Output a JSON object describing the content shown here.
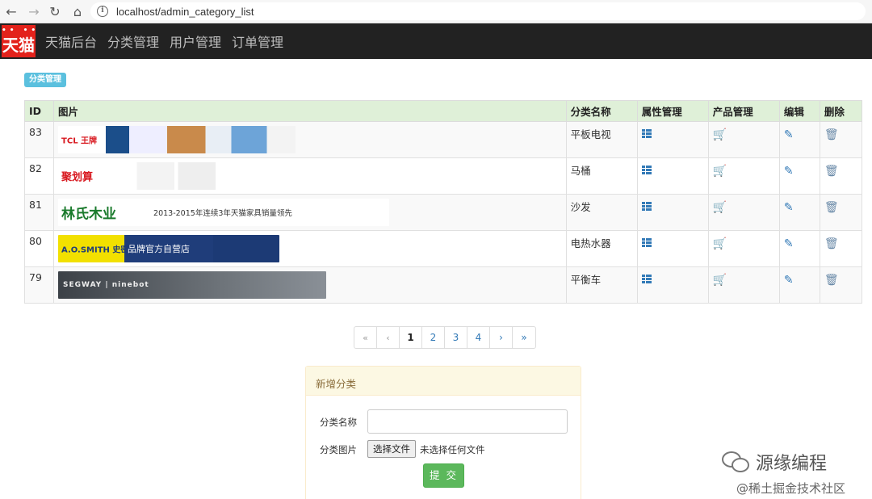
{
  "browser": {
    "url": "localhost/admin_category_list"
  },
  "app_nav": {
    "logo_text": "天猫",
    "items": [
      "天猫后台",
      "分类管理",
      "用户管理",
      "订单管理"
    ]
  },
  "breadcrumb": "分类管理",
  "table": {
    "headers": [
      "ID",
      "图片",
      "分类名称",
      "属性管理",
      "产品管理",
      "编辑",
      "删除"
    ],
    "rows": [
      {
        "id": "83",
        "name": "平板电视",
        "image_text": "TCL 王牌"
      },
      {
        "id": "82",
        "name": "马桶",
        "image_text": "聚划算"
      },
      {
        "id": "81",
        "name": "沙发",
        "image_text": "林氏木业",
        "image_subtext": "2013-2015年连续3年天猫家具销量领先"
      },
      {
        "id": "80",
        "name": "电热水器",
        "image_text": "A.O.SMITH 史密斯",
        "image_subtext": "品牌官方自营店"
      },
      {
        "id": "79",
        "name": "平衡车",
        "image_text": "SEGWAY | ninebot"
      }
    ]
  },
  "pagination": {
    "first": "«",
    "prev": "‹",
    "pages": [
      "1",
      "2",
      "3",
      "4"
    ],
    "current": "1",
    "next": "›",
    "last": "»"
  },
  "add_panel": {
    "title": "新增分类",
    "name_label": "分类名称",
    "image_label": "分类图片",
    "file_button": "选择文件",
    "file_status": "未选择任何文件",
    "submit": "提 交"
  },
  "watermark": {
    "main": "源缘编程",
    "sub": "@稀土掘金技术社区"
  }
}
